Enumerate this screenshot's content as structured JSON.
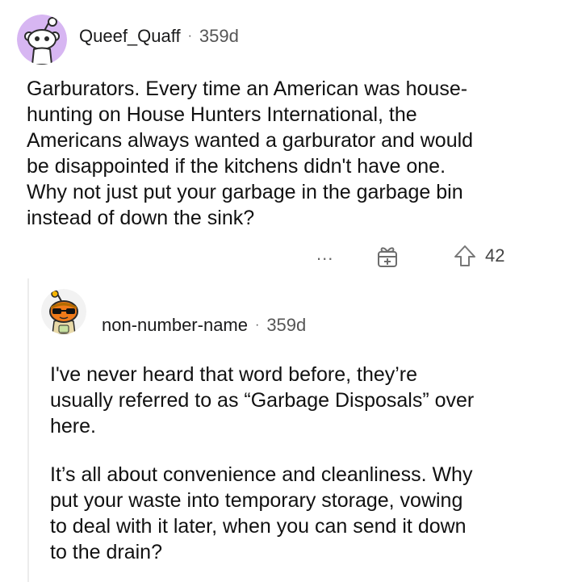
{
  "comment1": {
    "username": "Queef_Quaff",
    "age": "359d",
    "body_lines": [
      "Garburators. Every time an American was house-",
      "hunting on House Hunters International, the",
      "Americans always wanted a garburator and would",
      "be disappointed if the kitchens didn't have one.",
      "Why not just put your garbage in the garbage bin",
      "instead of down the sink?"
    ],
    "more_label": "...",
    "score": "42",
    "avatar_icon": "reddit-snoo-avatar-icon",
    "avatar_bg": "#d7b6f2"
  },
  "comment2": {
    "username": "non-number-name",
    "age": "359d",
    "paragraph1_lines": [
      "I've never heard that word before, they’re",
      "usually referred to as “Garbage Disposals” over",
      "here."
    ],
    "paragraph2_lines": [
      "It’s all about convenience and cleanliness.  Why",
      "put your waste into temporary storage, vowing",
      "to deal with it later, when you can send it down",
      "to the drain?"
    ],
    "avatar_icon": "snoo-sunglasses-avatar-icon"
  },
  "separator": "·"
}
